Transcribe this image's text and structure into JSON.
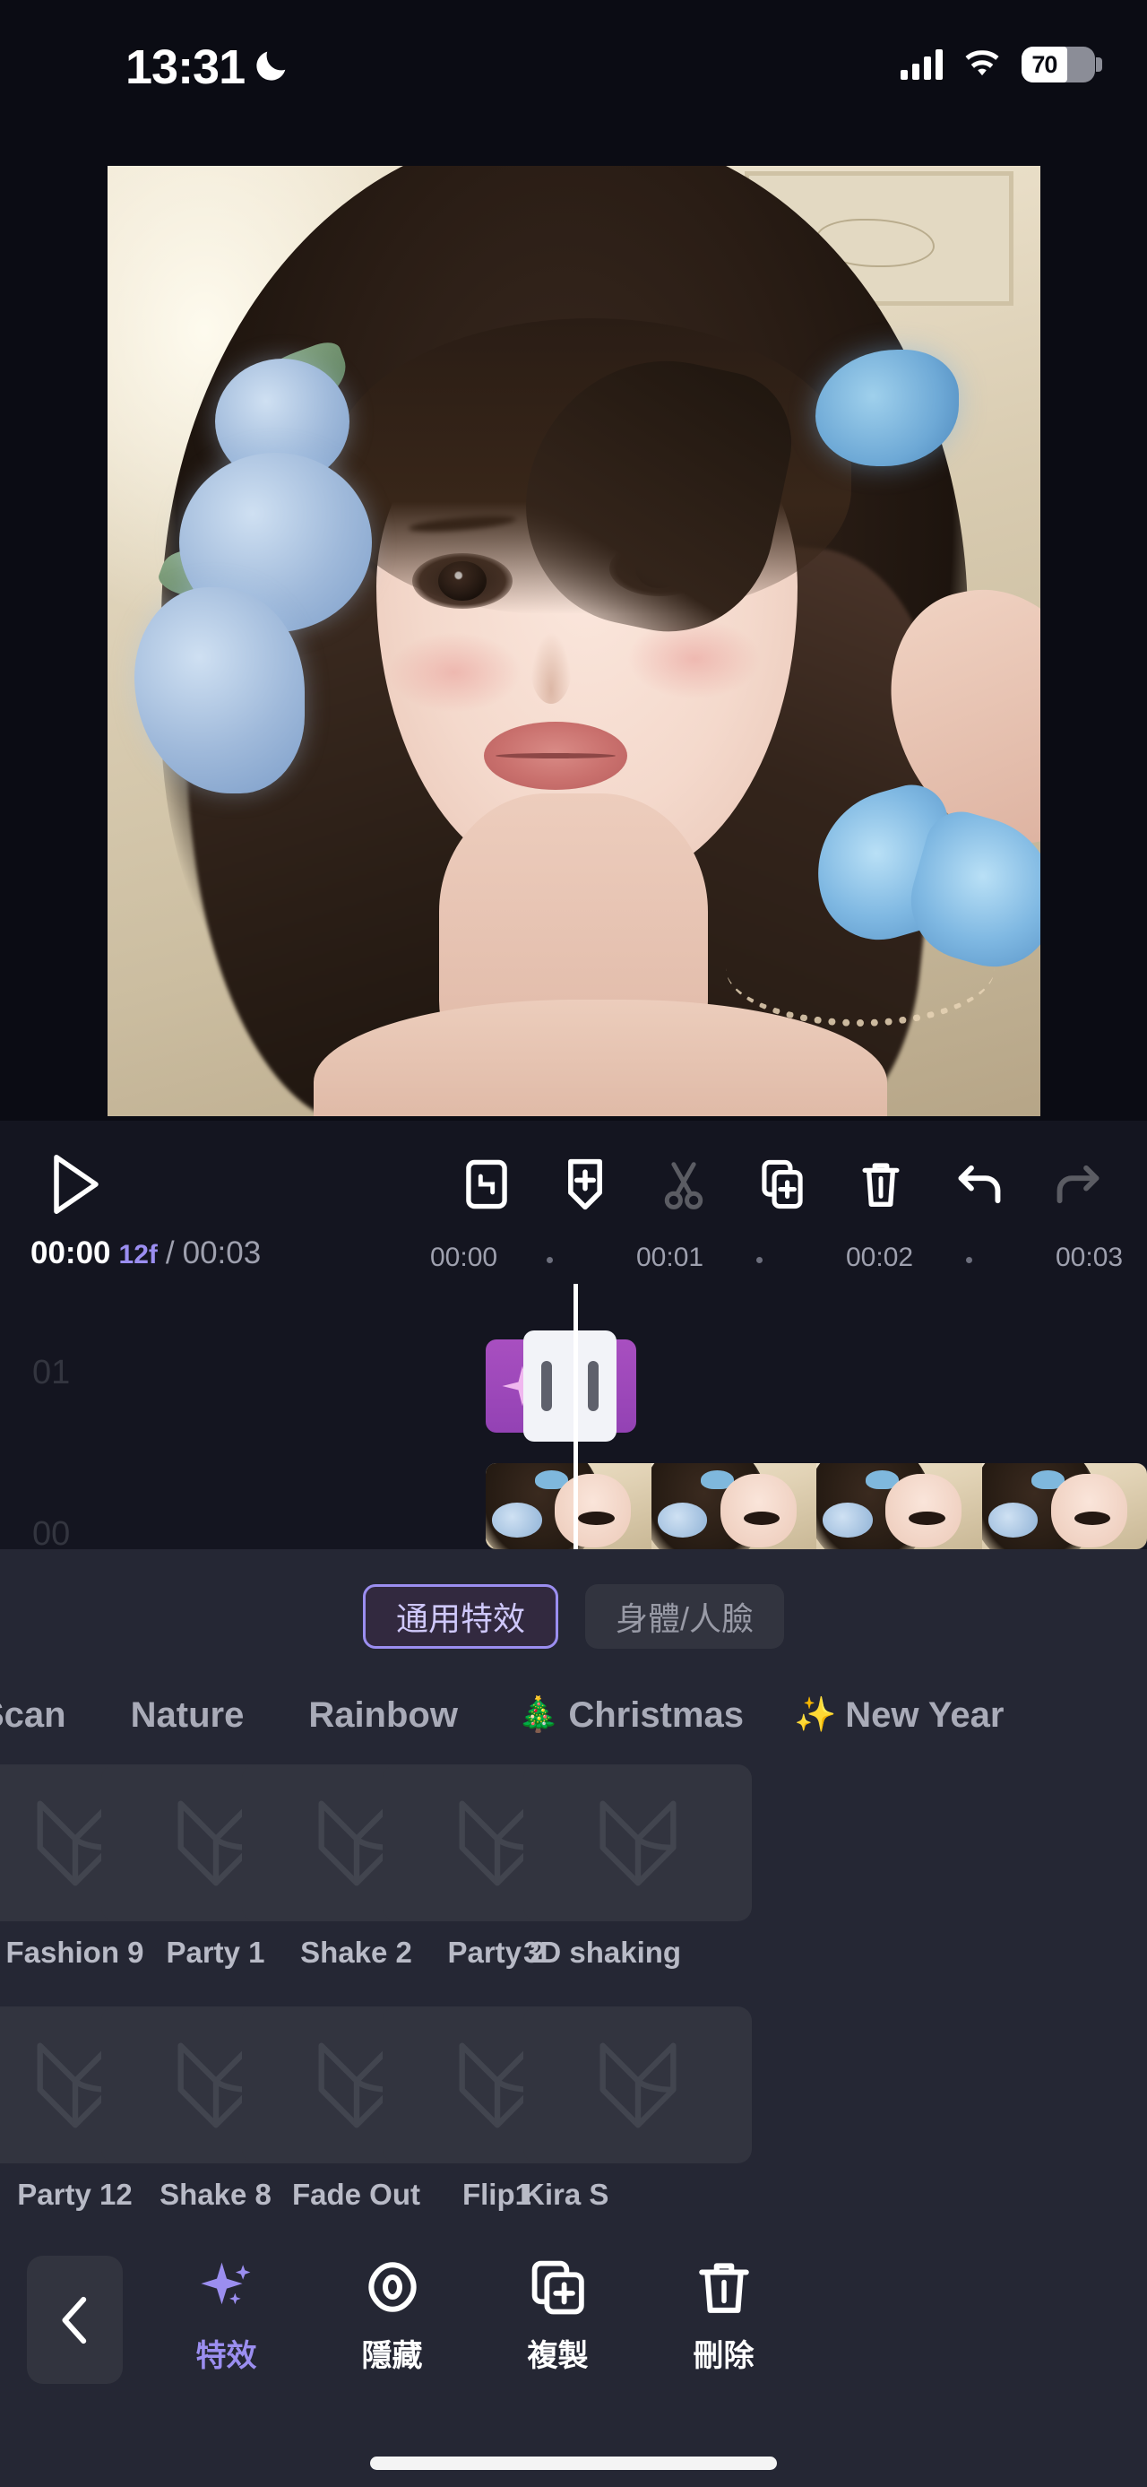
{
  "status_bar": {
    "time": "13:31",
    "moon_icon": "crescent-moon-icon",
    "signal_icon": "cellular-signal-icon",
    "wifi_icon": "wifi-icon",
    "battery_percent": "70"
  },
  "preview": {
    "label": "video-preview",
    "description": "Portrait of a woman with blue flowers and butterfly"
  },
  "toolbar": {
    "play_label": "play-icon",
    "items": [
      {
        "name": "fit-screen-icon",
        "label": "Fit to screen",
        "disabled": false
      },
      {
        "name": "add-keyframe-icon",
        "label": "Add keyframe",
        "disabled": false
      },
      {
        "name": "scissors-icon",
        "label": "Split",
        "disabled": true
      },
      {
        "name": "duplicate-icon",
        "label": "Duplicate",
        "disabled": false
      },
      {
        "name": "trash-icon",
        "label": "Delete",
        "disabled": false
      },
      {
        "name": "undo-icon",
        "label": "Undo",
        "disabled": false
      },
      {
        "name": "redo-icon",
        "label": "Redo",
        "disabled": true
      }
    ]
  },
  "timecode": {
    "current": "00:00",
    "frame": "12f",
    "separator": "/",
    "total": "00:03",
    "ruler_marks": [
      "00:00",
      "00:01",
      "00:02",
      "00:03"
    ]
  },
  "timeline": {
    "track_labels": [
      "01",
      "00"
    ],
    "effect_clip_icon": "sparkle-icon",
    "selected_clip": true
  },
  "tabs": [
    {
      "label": "通用特效",
      "active": true
    },
    {
      "label": "身體/人臉",
      "active": false
    }
  ],
  "categories": [
    {
      "label": "Scan",
      "emoji": ""
    },
    {
      "label": "Nature",
      "emoji": ""
    },
    {
      "label": "Rainbow",
      "emoji": ""
    },
    {
      "label": "Christmas",
      "emoji": "🎄"
    },
    {
      "label": "New Year",
      "emoji": "✨"
    }
  ],
  "effects": [
    {
      "name": "Fashion 9",
      "downloadable": true
    },
    {
      "name": "Party 1",
      "downloadable": true
    },
    {
      "name": "Shake 2",
      "downloadable": true
    },
    {
      "name": "Party 2",
      "downloadable": true
    },
    {
      "name": "3D shaking",
      "downloadable": true
    },
    {
      "name": "Party 12",
      "downloadable": true
    },
    {
      "name": "Shake 8",
      "downloadable": true
    },
    {
      "name": "Fade Out",
      "downloadable": true
    },
    {
      "name": "Flip1",
      "downloadable": true
    },
    {
      "name": "Kira S",
      "downloadable": true
    }
  ],
  "bottom_actions": {
    "back_icon": "chevron-left-icon",
    "items": [
      {
        "label": "特效",
        "icon": "sparkle-icon",
        "active": true
      },
      {
        "label": "隱藏",
        "icon": "eye-icon",
        "active": false
      },
      {
        "label": "複製",
        "icon": "duplicate-icon",
        "active": false
      },
      {
        "label": "刪除",
        "icon": "trash-icon",
        "active": false
      }
    ]
  },
  "colors": {
    "accent": "#9b8ef0",
    "panel_bg": "#252734",
    "editor_bg": "#141520",
    "screen_bg": "#0b0c14",
    "clip_purple": "#a84fc0"
  }
}
